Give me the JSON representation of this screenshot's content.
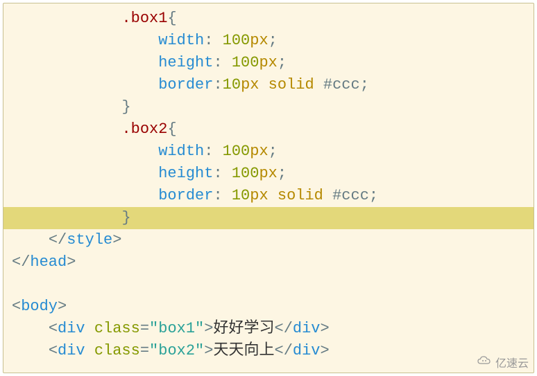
{
  "code": {
    "box1_selector": ".box1",
    "box2_selector": ".box2",
    "open_brace": "{",
    "close_brace": "}",
    "width_prop": "width",
    "height_prop": "height",
    "border_prop": "border",
    "val_100": "100",
    "px": "px",
    "val_10": "10",
    "solid": "solid",
    "color_ccc": "#ccc",
    "colon": ":",
    "semi": ";",
    "style_close": "style",
    "head_close": "head",
    "body_tag": "body",
    "div_tag": "div",
    "class_attr": "class",
    "box1_val": "\"box1\"",
    "box2_val": "\"box2\"",
    "text1": "好好学习",
    "text2": "天天向上",
    "lt": "<",
    "gt": ">",
    "slash": "/",
    "eq": "="
  },
  "watermark": {
    "text": "亿速云",
    "icon": "cloud-icon"
  }
}
